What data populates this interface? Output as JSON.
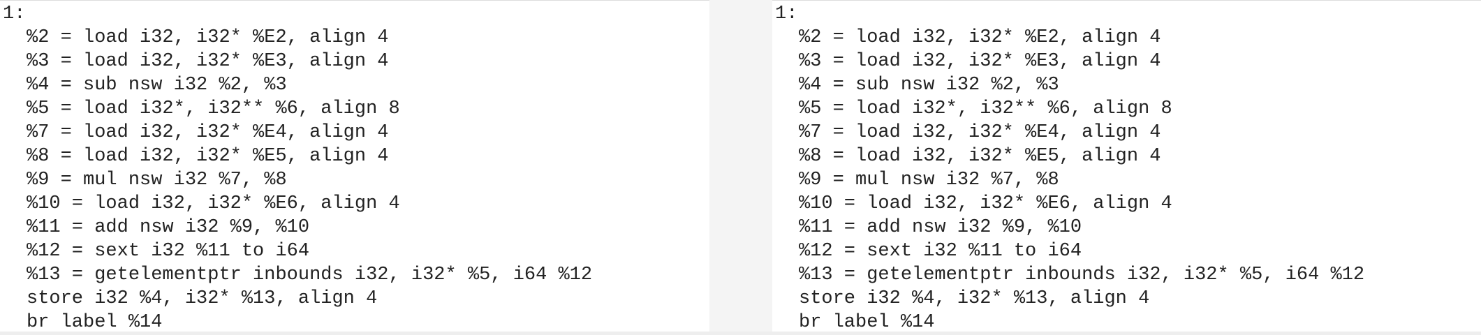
{
  "left_panel": {
    "lines": [
      "1:",
      "%2 = load i32, i32* %E2, align 4",
      "%3 = load i32, i32* %E3, align 4",
      "%4 = sub nsw i32 %2, %3",
      "%5 = load i32*, i32** %6, align 8",
      "%7 = load i32, i32* %E4, align 4",
      "%8 = load i32, i32* %E5, align 4",
      "%9 = mul nsw i32 %7, %8",
      "%10 = load i32, i32* %E6, align 4",
      "%11 = add nsw i32 %9, %10",
      "%12 = sext i32 %11 to i64",
      "%13 = getelementptr inbounds i32, i32* %5, i64 %12",
      "store i32 %4, i32* %13, align 4",
      "br label %14"
    ]
  },
  "right_panel": {
    "lines": [
      "1:",
      "%2 = load i32, i32* %E2, align 4",
      "%3 = load i32, i32* %E3, align 4",
      "%4 = sub nsw i32 %2, %3",
      "%5 = load i32*, i32** %6, align 8",
      "%7 = load i32, i32* %E4, align 4",
      "%8 = load i32, i32* %E5, align 4",
      "%9 = mul nsw i32 %7, %8",
      "%10 = load i32, i32* %E6, align 4",
      "%11 = add nsw i32 %9, %10",
      "%12 = sext i32 %11 to i64",
      "%13 = getelementptr inbounds i32, i32* %5, i64 %12",
      "store i32 %4, i32* %13, align 4",
      "br label %14"
    ]
  }
}
